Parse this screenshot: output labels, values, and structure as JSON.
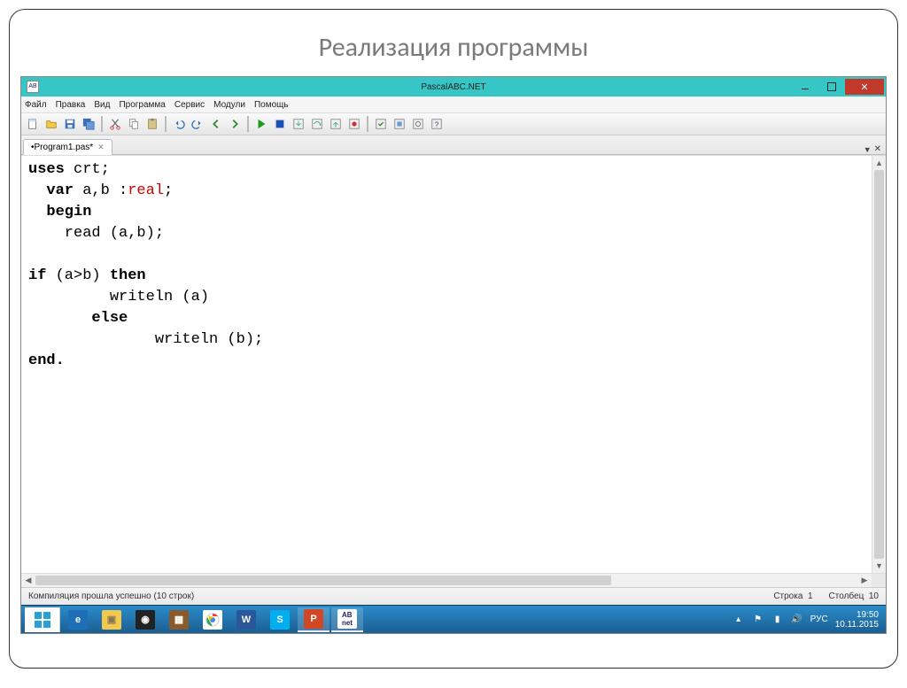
{
  "slide": {
    "title": "Реализация программы"
  },
  "window": {
    "title": "PascalABC.NET"
  },
  "menu": {
    "file": "Файл",
    "edit": "Правка",
    "view": "Вид",
    "program": "Программа",
    "service": "Сервис",
    "modules": "Модули",
    "help": "Помощь"
  },
  "tab": {
    "name": "•Program1.pas*"
  },
  "code": {
    "l1a": "uses",
    "l1b": " crt;",
    "l2a": "  var",
    "l2b": " a,b :",
    "l2c": "real",
    "l2d": ";",
    "l3a": "  begin",
    "l4": "    read (a,b);",
    "l5": "",
    "l6a": "if",
    "l6b": " (a>b) ",
    "l6c": "then",
    "l7": "         writeln (a)",
    "l8a": "       else",
    "l9": "              writeln (b);",
    "l10": "end."
  },
  "status": {
    "left": "Компиляция прошла успешно (10 строк)",
    "line_label": "Строка",
    "line_val": "1",
    "col_label": "Столбец",
    "col_val": "10"
  },
  "tray": {
    "lang": "РУС",
    "time": "19:50",
    "date": "10.11.2015"
  }
}
